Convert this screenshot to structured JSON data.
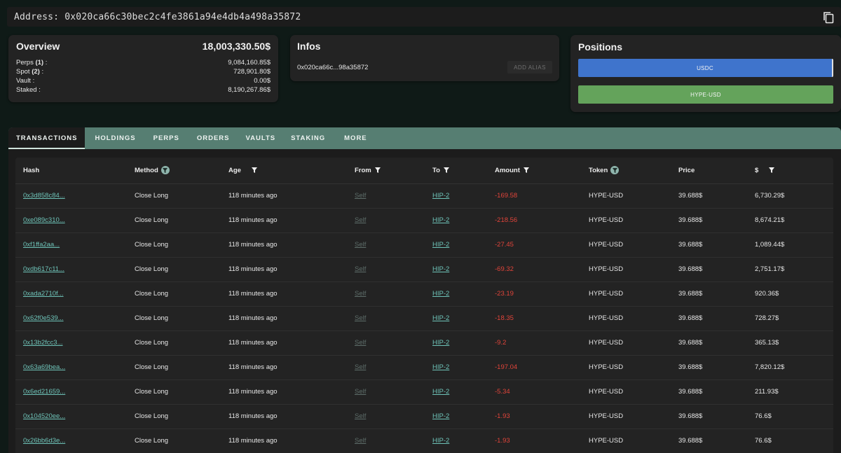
{
  "address_bar": {
    "label": "Address: 0x020ca66c30bec2c4fe3861a94e4db4a498a35872",
    "copy_icon": "copy-icon"
  },
  "overview": {
    "title": "Overview",
    "total": "18,003,330.50$",
    "rows": [
      {
        "label": "Perps ",
        "count": "(1)",
        "suffix": " :",
        "value": "9,084,160.85$"
      },
      {
        "label": "Spot ",
        "count": "(2)",
        "suffix": " :",
        "value": "728,901.80$"
      },
      {
        "label": "Vault",
        "count": "",
        "suffix": " :",
        "value": "0.00$"
      },
      {
        "label": "Staked",
        "count": "",
        "suffix": " :",
        "value": "8,190,267.86$"
      }
    ]
  },
  "infos": {
    "title": "Infos",
    "short_address": "0x020ca66c...98a35872",
    "add_alias_label": "ADD ALIAS"
  },
  "positions": {
    "title": "Positions",
    "items": [
      {
        "label": "USDC",
        "color": "#3f74cc"
      },
      {
        "label": "HYPE-USD",
        "color": "#64a35b"
      }
    ]
  },
  "tabs": [
    {
      "label": "TRANSACTIONS",
      "active": true
    },
    {
      "label": "HOLDINGS",
      "active": false
    },
    {
      "label": "PERPS",
      "active": false
    },
    {
      "label": "ORDERS",
      "active": false
    },
    {
      "label": "VAULTS",
      "active": false
    },
    {
      "label": "STAKING",
      "active": false
    },
    {
      "label": "MORE",
      "active": false
    }
  ],
  "table": {
    "columns": [
      {
        "label": "Hash",
        "filter": "none"
      },
      {
        "label": "Method",
        "filter": "circle"
      },
      {
        "label": "Age",
        "filter": "plain"
      },
      {
        "label": "From",
        "filter": "plain"
      },
      {
        "label": "To",
        "filter": "plain"
      },
      {
        "label": "Amount",
        "filter": "plain"
      },
      {
        "label": "Token",
        "filter": "circle"
      },
      {
        "label": "Price",
        "filter": "none"
      },
      {
        "label": "$",
        "filter": "plain"
      }
    ],
    "rows": [
      {
        "hash": "0x3d858c84...",
        "method": "Close Long",
        "age": "118 minutes ago",
        "from": "Self",
        "to": "HIP-2",
        "amount": "-169.58",
        "token": "HYPE-USD",
        "price": "39.688$",
        "usd": "6,730.29$"
      },
      {
        "hash": "0xe089c310...",
        "method": "Close Long",
        "age": "118 minutes ago",
        "from": "Self",
        "to": "HIP-2",
        "amount": "-218.56",
        "token": "HYPE-USD",
        "price": "39.688$",
        "usd": "8,674.21$"
      },
      {
        "hash": "0xf1ffa2aa...",
        "method": "Close Long",
        "age": "118 minutes ago",
        "from": "Self",
        "to": "HIP-2",
        "amount": "-27.45",
        "token": "HYPE-USD",
        "price": "39.688$",
        "usd": "1,089.44$"
      },
      {
        "hash": "0xdb617c11...",
        "method": "Close Long",
        "age": "118 minutes ago",
        "from": "Self",
        "to": "HIP-2",
        "amount": "-69.32",
        "token": "HYPE-USD",
        "price": "39.688$",
        "usd": "2,751.17$"
      },
      {
        "hash": "0xada2710f...",
        "method": "Close Long",
        "age": "118 minutes ago",
        "from": "Self",
        "to": "HIP-2",
        "amount": "-23.19",
        "token": "HYPE-USD",
        "price": "39.688$",
        "usd": "920.36$"
      },
      {
        "hash": "0x62f0e539...",
        "method": "Close Long",
        "age": "118 minutes ago",
        "from": "Self",
        "to": "HIP-2",
        "amount": "-18.35",
        "token": "HYPE-USD",
        "price": "39.688$",
        "usd": "728.27$"
      },
      {
        "hash": "0x13b2fcc3...",
        "method": "Close Long",
        "age": "118 minutes ago",
        "from": "Self",
        "to": "HIP-2",
        "amount": "-9.2",
        "token": "HYPE-USD",
        "price": "39.688$",
        "usd": "365.13$"
      },
      {
        "hash": "0x63a69bea...",
        "method": "Close Long",
        "age": "118 minutes ago",
        "from": "Self",
        "to": "HIP-2",
        "amount": "-197.04",
        "token": "HYPE-USD",
        "price": "39.688$",
        "usd": "7,820.12$"
      },
      {
        "hash": "0x6ed21659...",
        "method": "Close Long",
        "age": "118 minutes ago",
        "from": "Self",
        "to": "HIP-2",
        "amount": "-5.34",
        "token": "HYPE-USD",
        "price": "39.688$",
        "usd": "211.93$"
      },
      {
        "hash": "0x104520ee...",
        "method": "Close Long",
        "age": "118 minutes ago",
        "from": "Self",
        "to": "HIP-2",
        "amount": "-1.93",
        "token": "HYPE-USD",
        "price": "39.688$",
        "usd": "76.6$"
      },
      {
        "hash": "0x26bb6d3e...",
        "method": "Close Long",
        "age": "118 minutes ago",
        "from": "Self",
        "to": "HIP-2",
        "amount": "-1.93",
        "token": "HYPE-USD",
        "price": "39.688$",
        "usd": "76.6$"
      }
    ]
  },
  "colors": {
    "accent_teal": "#567e72",
    "negative": "#e0443a",
    "link": "#6ec3b8"
  }
}
